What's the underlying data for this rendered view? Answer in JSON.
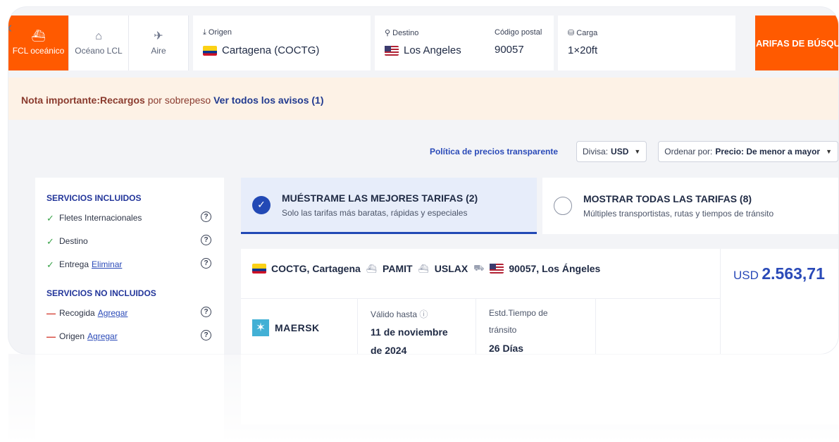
{
  "search": {
    "modes": [
      {
        "label": "FCL oceánico",
        "icon": "container-ship-icon"
      },
      {
        "label": "Océano LCL",
        "icon": "warehouse-icon"
      },
      {
        "label": "Aire",
        "icon": "airplane-icon"
      }
    ],
    "origin": {
      "label": "Origen",
      "value": "Cartagena (COCTG)"
    },
    "destination": {
      "label": "Destino",
      "value": "Los Angeles"
    },
    "postal": {
      "label": "Código postal",
      "value": "90057"
    },
    "cargo": {
      "label": "Carga",
      "value": "1×20ft"
    },
    "search_button": "ARIFAS DE BÚSQU"
  },
  "notice": {
    "important": "Nota importante:Recargos",
    "surcharge": " por sobrepeso",
    "link": " Ver todos los avisos (1)"
  },
  "controls": {
    "policy": "Política de precios transparente",
    "currency_label": "Divisa:",
    "currency_value": "USD",
    "sort_label": "Ordenar por:",
    "sort_value": "Precio: De menor a mayor"
  },
  "sidebar": {
    "included_title": "SERVICIOS INCLUIDOS",
    "included": [
      {
        "label": "Fletes Internacionales",
        "action": ""
      },
      {
        "label": "Destino",
        "action": ""
      },
      {
        "label": "Entrega",
        "action": "Eliminar"
      }
    ],
    "excluded_title": "SERVICIOS NO INCLUIDOS",
    "excluded": [
      {
        "label": "Recogida",
        "action": "Agregar"
      },
      {
        "label": "Origen",
        "action": "Agregar"
      }
    ]
  },
  "tabs": {
    "best": {
      "title": "MUÉSTRAME LAS MEJORES TARIFAS (2)",
      "subtitle": "Solo las tarifas más baratas, rápidas y especiales"
    },
    "all": {
      "title": "MOSTRAR TODAS LAS TARIFAS (8)",
      "subtitle": "Múltiples transportistas, rutas y tiempos de tránsito"
    }
  },
  "result": {
    "route": {
      "origin": "COCTG, Cartagena",
      "via1": "PAMIT",
      "via2": "USLAX",
      "destination": "90057, Los Ángeles"
    },
    "carrier": "MAERSK",
    "valid_label": "Válido hasta",
    "valid_line1": "11 de noviembre",
    "valid_line2": "de 2024",
    "transit_label_1": "Estd.Tiempo de",
    "transit_label_2": "tránsito",
    "transit_value": "26 Días",
    "price_currency": "USD",
    "price_amount": "2.563,71"
  },
  "colors": {
    "accent_orange": "#ff5a00",
    "brand_blue": "#2249b5",
    "notice_bg": "#fdf2e6"
  }
}
